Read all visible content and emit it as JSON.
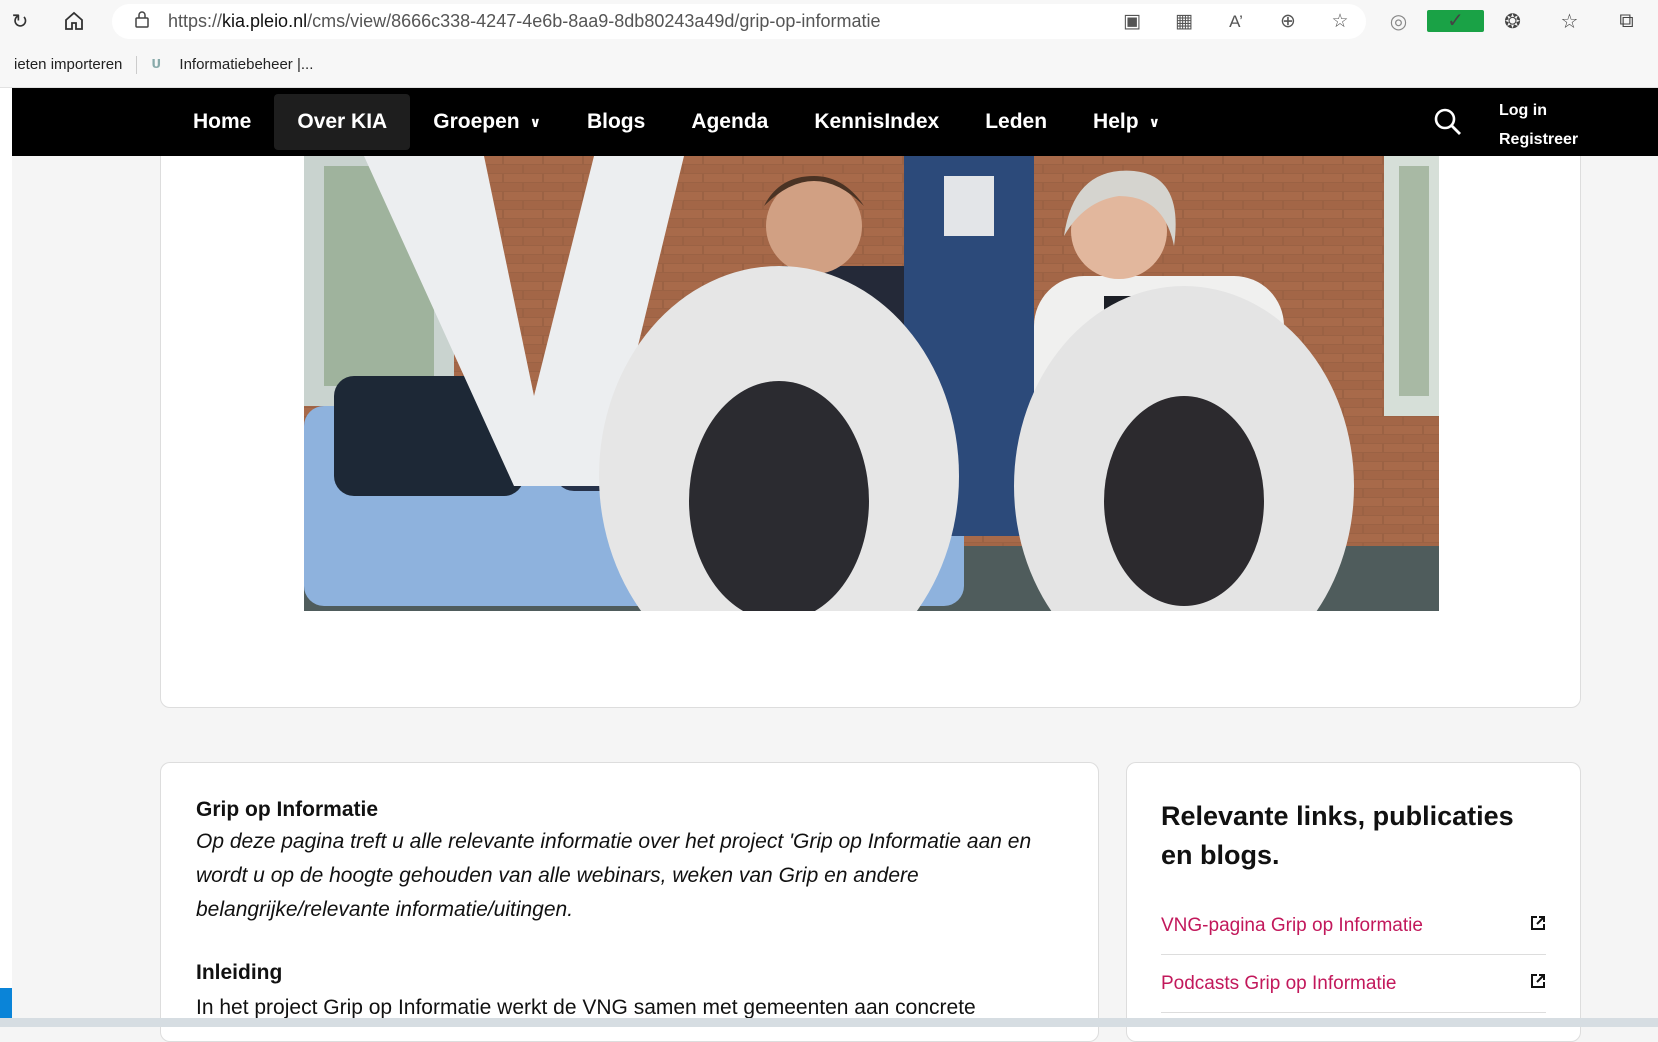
{
  "browser": {
    "url_prefix": "https://",
    "url_host": "kia.pleio.nl",
    "url_path": "/cms/view/8666c338-4247-4e6b-8aa9-8db80243a49d/grip-op-informatie"
  },
  "bookmarks": {
    "items": [
      "ieten importeren",
      "Informatiebeheer |..."
    ]
  },
  "nav": {
    "items": [
      {
        "label": "Home"
      },
      {
        "label": "Over KIA"
      },
      {
        "label": "Groepen"
      },
      {
        "label": "Blogs"
      },
      {
        "label": "Agenda"
      },
      {
        "label": "KennisIndex"
      },
      {
        "label": "Leden"
      },
      {
        "label": "Help"
      }
    ],
    "login": "Log in",
    "register": "Registreer"
  },
  "article": {
    "heading": "Grip op Informatie",
    "intro": "Op deze pagina treft u alle relevante informatie over het project 'Grip op Informatie aan en wordt u op de hoogte gehouden van alle webinars, weken van Grip en andere belangrijke/relevante informatie/uitingen.",
    "subheading": "Inleiding",
    "body": "In het project Grip op Informatie werkt de VNG samen met gemeenten aan concrete"
  },
  "sidebar": {
    "title": "Relevante links, publicaties en blogs.",
    "links": [
      {
        "label": "VNG-pagina Grip op Informatie"
      },
      {
        "label": "Podcasts Grip op Informatie"
      }
    ]
  },
  "colors": {
    "nav_bg": "#000000",
    "link": "#c2185b",
    "check_ext": "#1aa246"
  }
}
